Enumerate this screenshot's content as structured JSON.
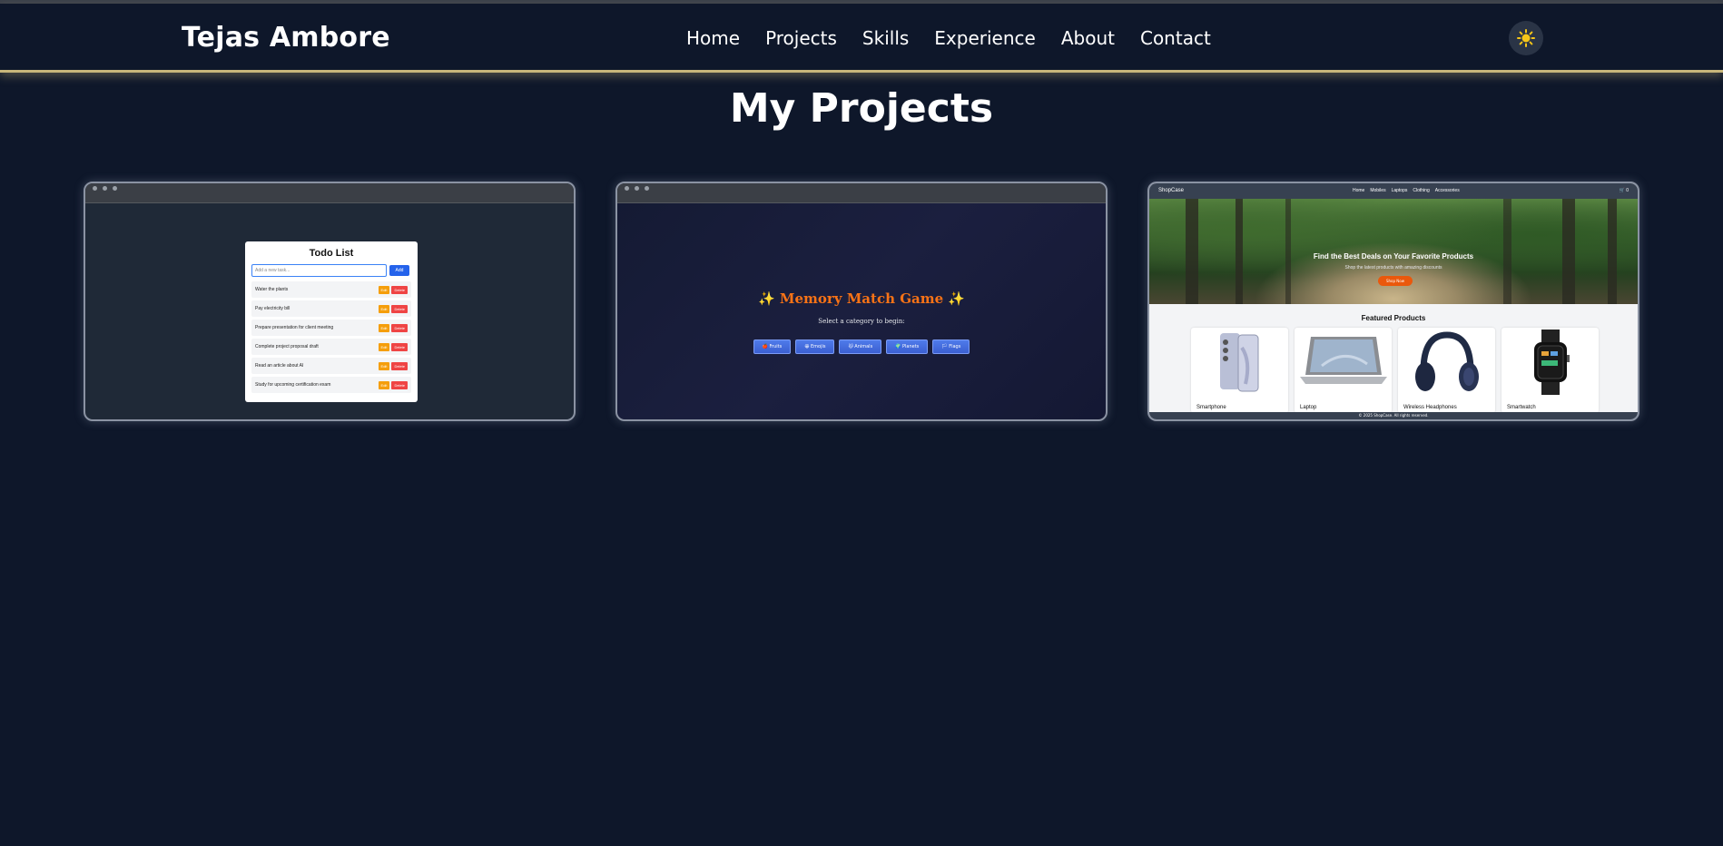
{
  "header": {
    "brand": "Tejas Ambore",
    "nav": [
      "Home",
      "Projects",
      "Skills",
      "Experience",
      "About",
      "Contact"
    ],
    "theme_toggle_icon": "sun-icon"
  },
  "projects_section": {
    "title": "My Projects",
    "projects": [
      {
        "name": "Todo List",
        "input_placeholder": "Add a new task...",
        "add_label": "Add",
        "tasks": [
          "Water the plants",
          "Pay electricity bill",
          "Prepare presentation for client meeting",
          "Complete project proposal draft",
          "Read an article about AI",
          "Study for upcoming certification exam"
        ],
        "edit_label": "Edit",
        "delete_label": "Delete"
      },
      {
        "name": "✨ Memory Match Game ✨",
        "subtitle": "Select a category to begin:",
        "categories": [
          "🍎 Fruits",
          "😀 Emojis",
          "🐱 Animals",
          "🌍 Planets",
          "🏳 Flags"
        ]
      },
      {
        "name": "ShopCase",
        "nav_links": [
          "Home",
          "Mobiles",
          "Laptops",
          "Clothing",
          "Accessories"
        ],
        "cart": "🛒 0",
        "hero_title": "Find the Best Deals on Your Favorite Products",
        "hero_subtitle": "Shop the latest products with amazing discounts",
        "shop_now_label": "Shop Now",
        "featured_title": "Featured Products",
        "products": [
          "Smartphone",
          "Laptop",
          "Wireless Headphones",
          "Smartwatch"
        ],
        "footer": "© 2025 ShopCase. All rights reserved."
      }
    ]
  },
  "colors": {
    "background": "#0e172a",
    "header_border": "#c8b67a",
    "memory_title": "#f97316"
  }
}
